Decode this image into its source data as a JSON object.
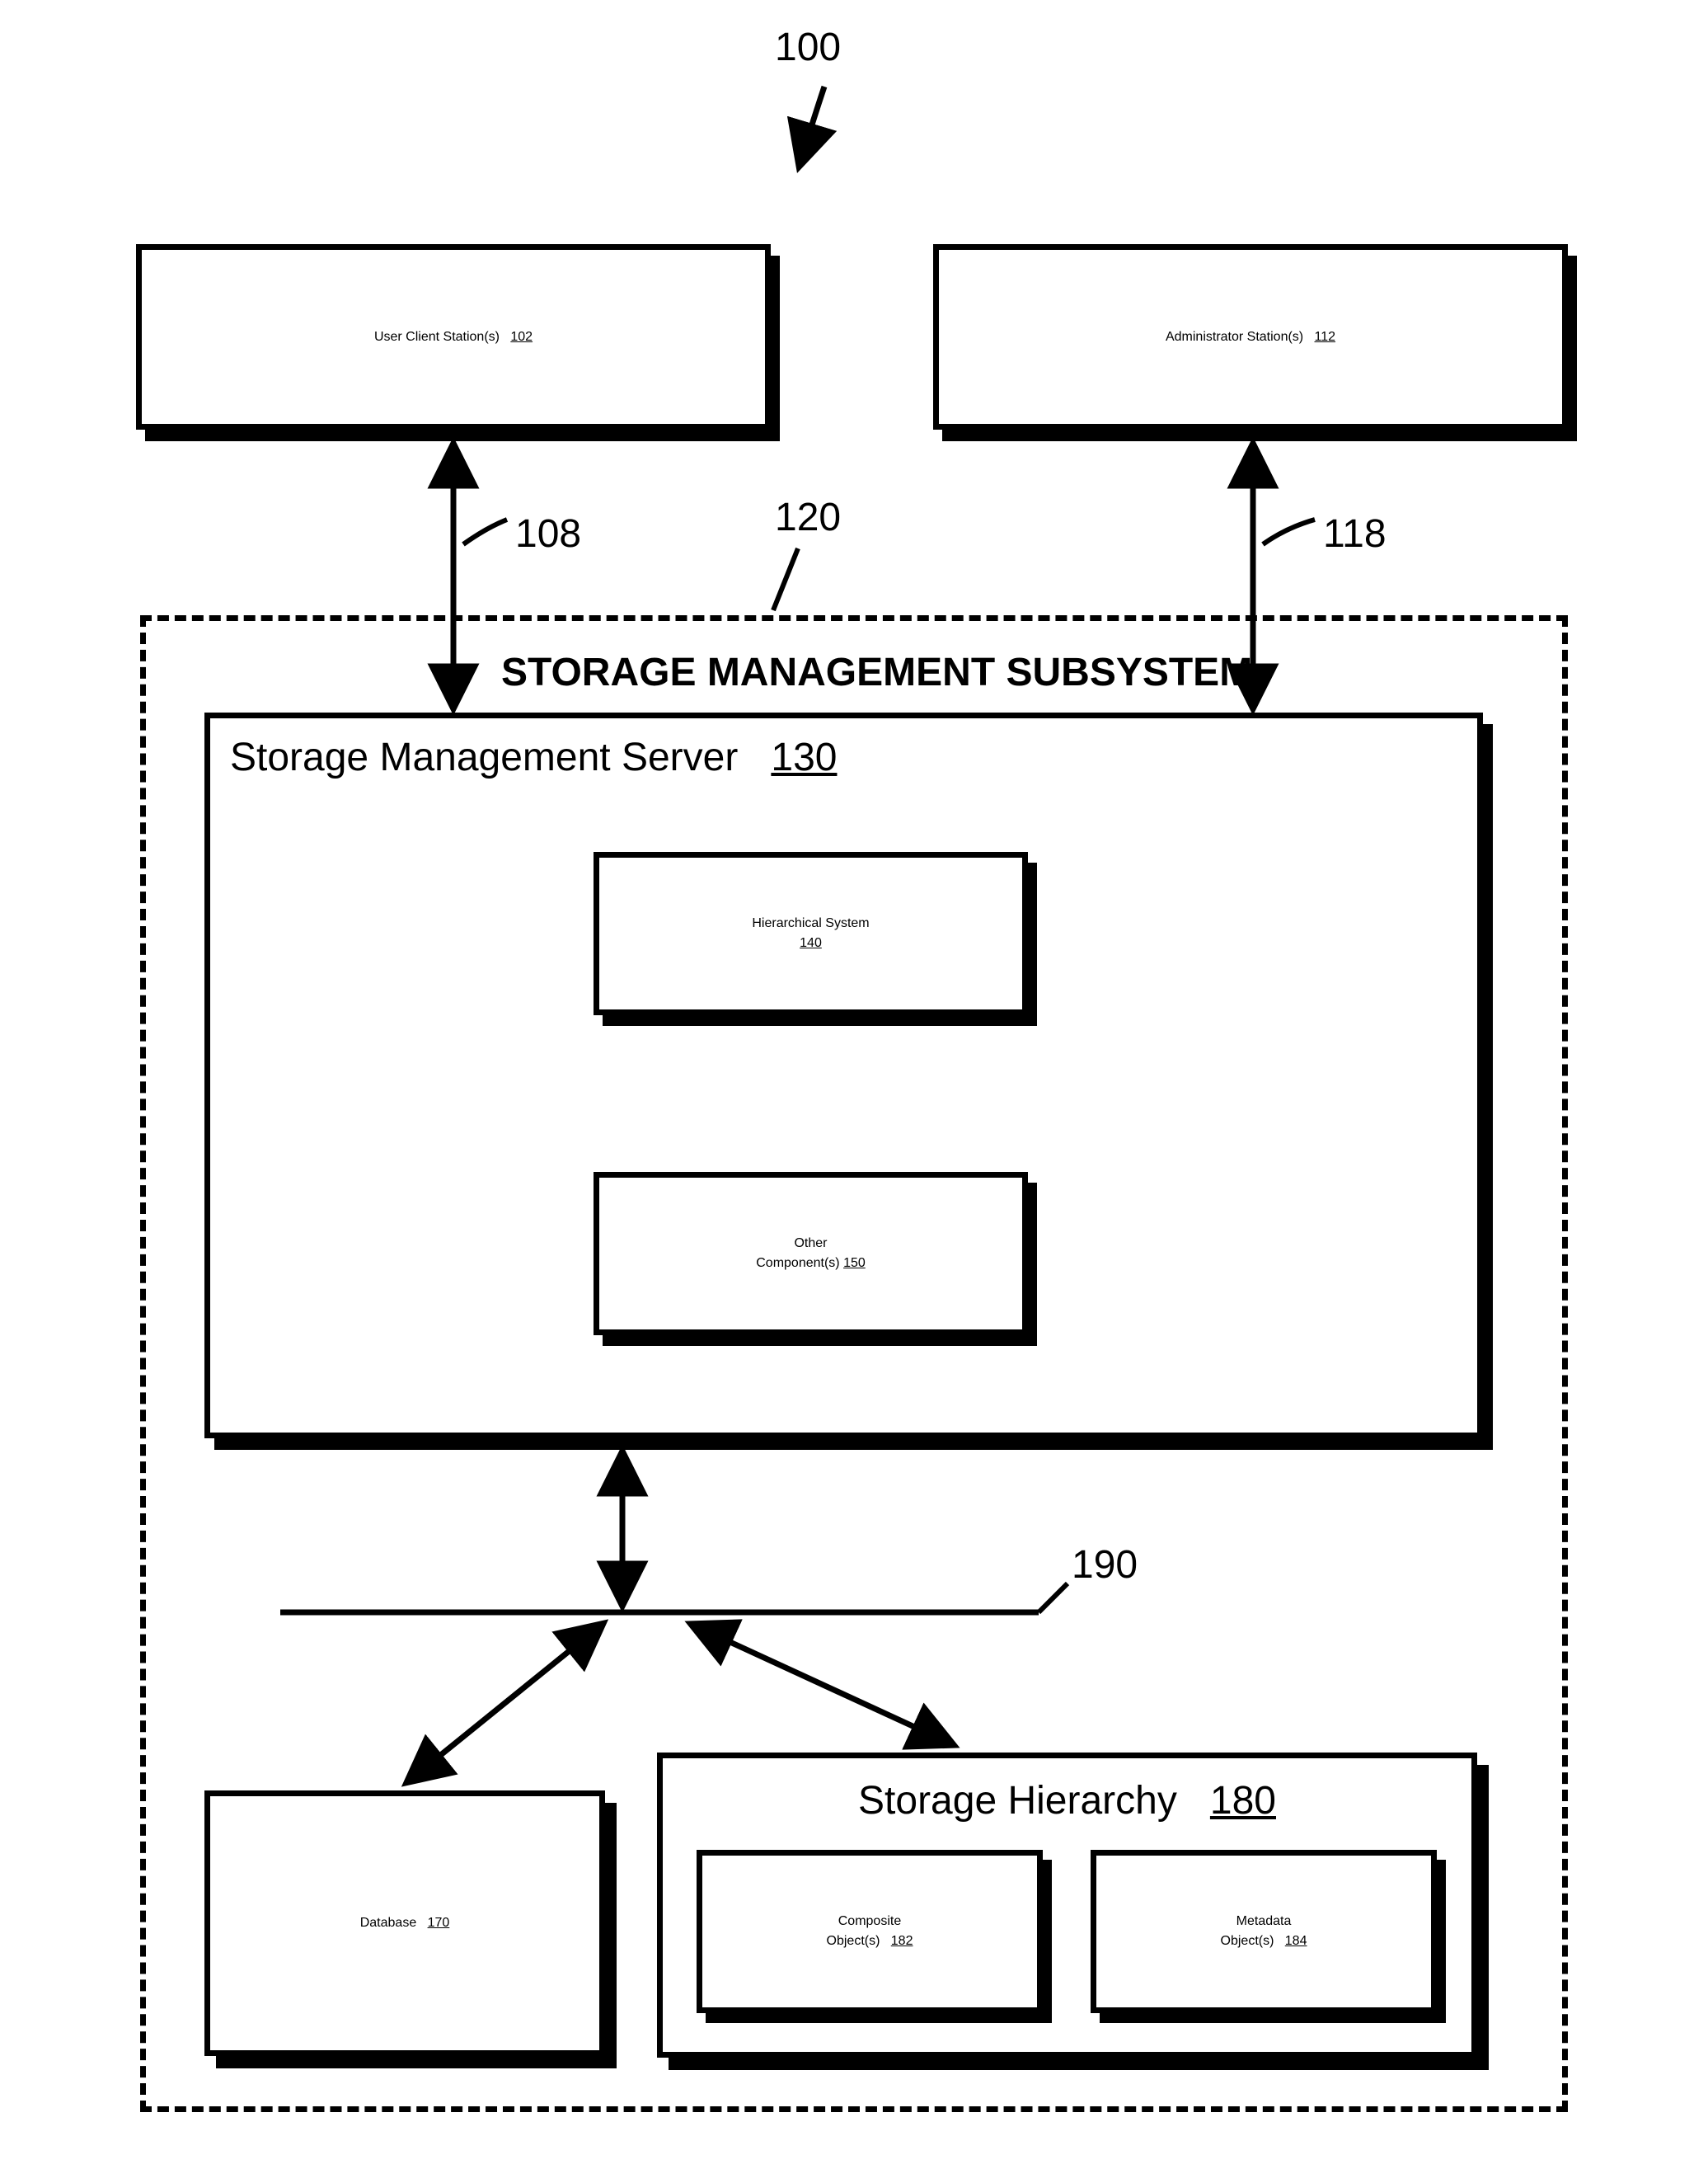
{
  "refs": {
    "fig100": "100",
    "ucs": {
      "label": "User Client Station(s)",
      "num": "102"
    },
    "adm": {
      "label": "Administrator Station(s)",
      "num": "112"
    },
    "t108": "108",
    "t118": "118",
    "t120": "120",
    "subsys_title": "STORAGE MANAGEMENT SUBSYSTEM",
    "sms": {
      "label": "Storage Management Server",
      "num": "130"
    },
    "hier": {
      "label": "Hierarchical System",
      "num": "140"
    },
    "other": {
      "label": "Other Component(s)",
      "num": "150"
    },
    "t190": "190",
    "db": {
      "label": "Database",
      "num": "170"
    },
    "sh": {
      "label": "Storage Hierarchy",
      "num": "180"
    },
    "comp": {
      "label": "Composite Object(s)",
      "num": "182"
    },
    "meta": {
      "label": "Metadata Object(s)",
      "num": "184"
    }
  }
}
